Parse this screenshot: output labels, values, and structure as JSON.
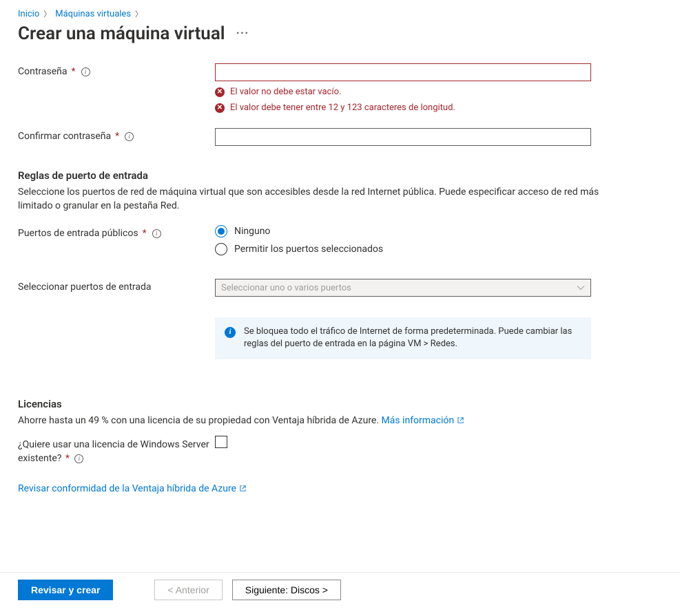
{
  "breadcrumb": {
    "home": "Inicio",
    "vms": "Máquinas virtuales"
  },
  "page_title": "Crear una máquina virtual",
  "password": {
    "label": "Contraseña",
    "err1": "El valor no debe estar vacío.",
    "err2": "El valor debe tener entre 12 y 123 caracteres de longitud."
  },
  "confirm_password": {
    "label": "Confirmar contraseña"
  },
  "inbound": {
    "title": "Reglas de puerto de entrada",
    "desc": "Seleccione los puertos de red de máquina virtual que son accesibles desde la red Internet pública. Puede especificar acceso de red más limitado o granular en la pestaña Red.",
    "public_label": "Puertos de entrada públicos",
    "opt_none": "Ninguno",
    "opt_allow": "Permitir los puertos seleccionados",
    "select_label": "Seleccionar puertos de entrada",
    "select_placeholder": "Seleccionar uno o varios puertos",
    "info": "Se bloquea todo el tráfico de Internet de forma predeterminada. Puede cambiar las reglas del puerto de entrada en la página VM > Redes."
  },
  "licensing": {
    "title": "Licencias",
    "desc_pre": "Ahorre hasta un 49 % con una licencia de su propiedad con Ventaja híbrida de Azure. ",
    "learn_more": "Más información",
    "question": "¿Quiere usar una licencia de Windows Server existente?",
    "review_link": "Revisar conformidad de la Ventaja híbrida de Azure"
  },
  "footer": {
    "review": "Revisar y crear",
    "prev": "< Anterior",
    "next": "Siguiente: Discos >"
  }
}
